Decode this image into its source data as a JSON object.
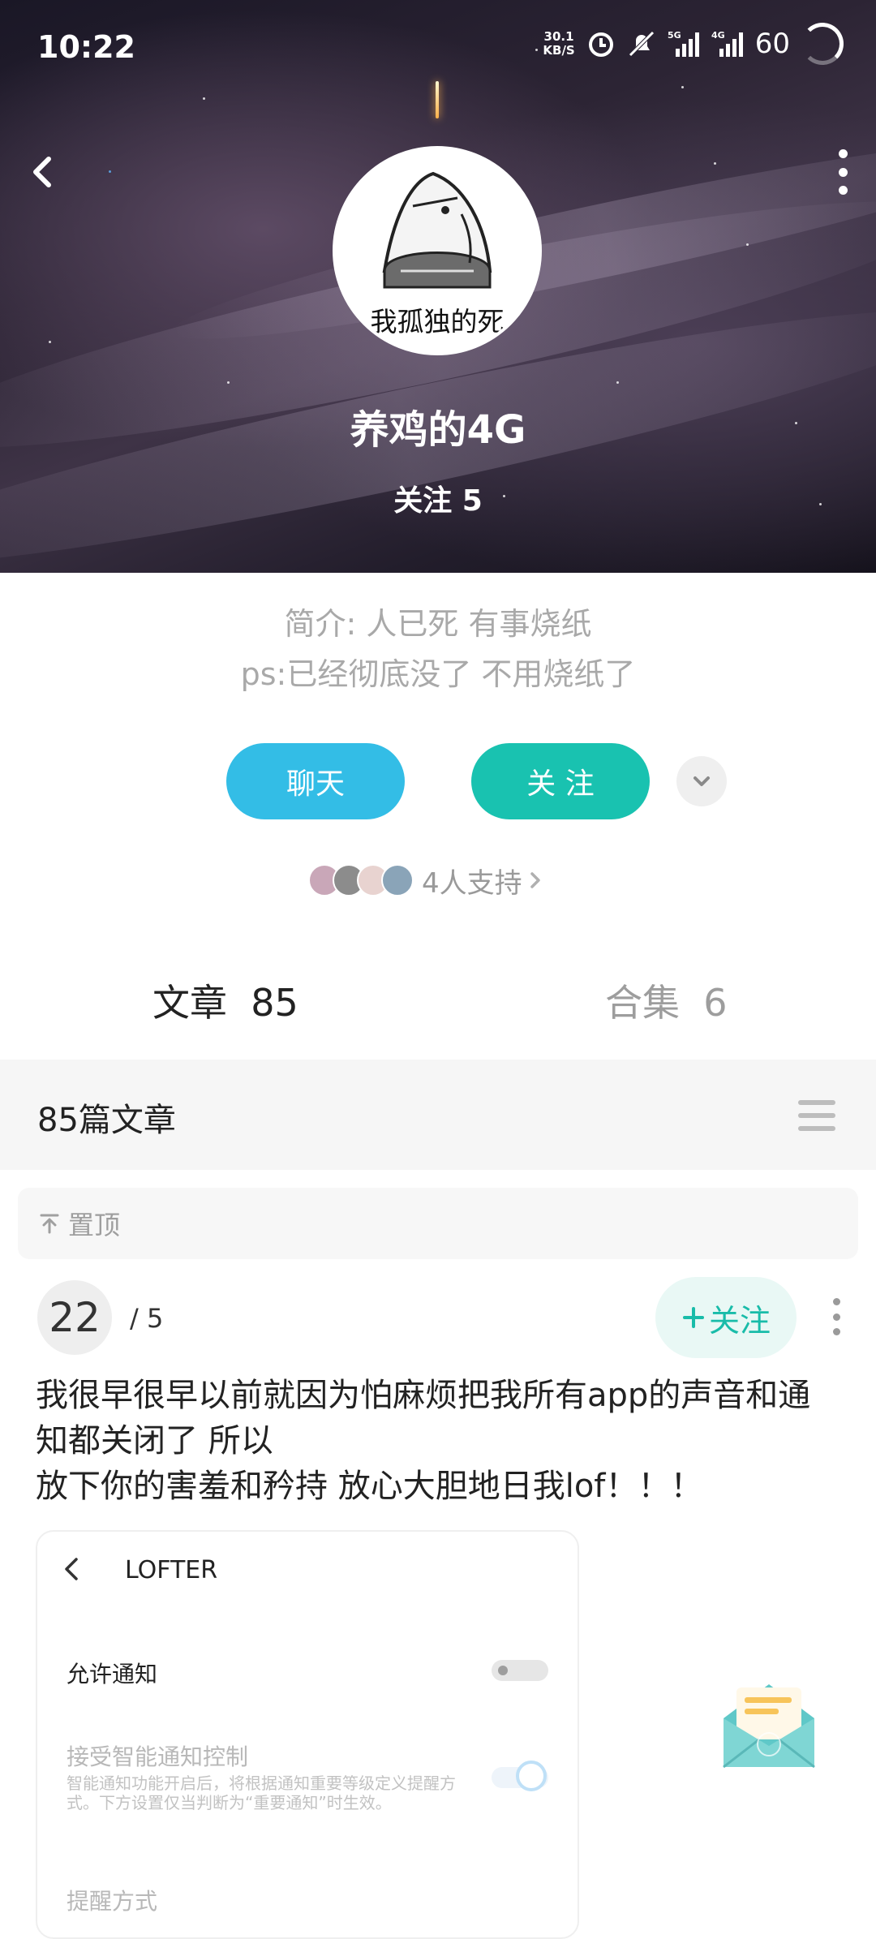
{
  "status_bar": {
    "time": "10:22",
    "net_speed_value": "30.1",
    "net_speed_unit": "KB/S",
    "battery": "60"
  },
  "profile": {
    "avatar_caption": "我孤独的死",
    "username": "养鸡的4G",
    "following": "关注 5"
  },
  "bio": {
    "line1": "简介: 人已死 有事烧纸",
    "line2": "ps:已经彻底没了 不用烧纸了"
  },
  "actions": {
    "chat_label": "聊天",
    "follow_label": "关 注"
  },
  "supporters": {
    "label": "4人支持",
    "colors": [
      "#c9a7b8",
      "#8c8c8c",
      "#e8d3d0",
      "#8aa4b8"
    ]
  },
  "tabs": [
    {
      "label": "文章",
      "count": "85"
    },
    {
      "label": "合集",
      "count": "6"
    }
  ],
  "list_header": {
    "title": "85篇文章"
  },
  "pinned": {
    "label": "置顶"
  },
  "post": {
    "day": "22",
    "month": "/ 5",
    "follow_label": "关注",
    "text_lines": [
      "我很早很早以前就因为怕麻烦把我所有app的声音和通",
      "知都关闭了 所以",
      "放下你的害羞和矜持 放心大胆地日我lof！！！"
    ],
    "screenshot": {
      "app_title": "LOFTER",
      "row1": "允许通知",
      "row2_title": "接受智能通知控制",
      "row2_desc": "智能通知功能开启后，将根据通知重要等级定义提醒方式。下方设置仅当判断为“重要通知”时生效。",
      "row3": "提醒方式"
    }
  },
  "colors": {
    "chat": "#33bde6",
    "follow": "#19c2b0",
    "accent": "#19bca9"
  }
}
